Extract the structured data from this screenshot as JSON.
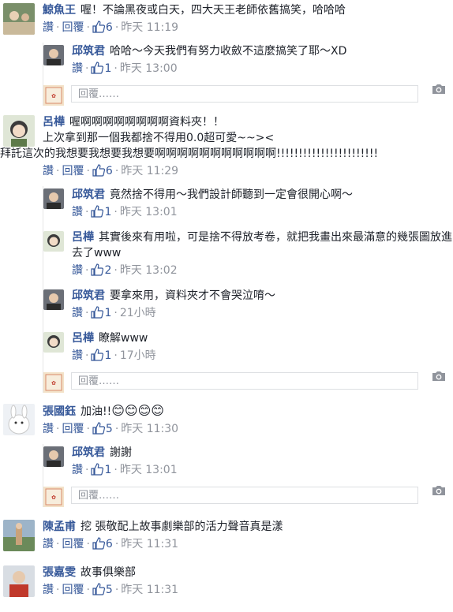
{
  "labels": {
    "like": "讚",
    "reply": "回覆",
    "reply_placeholder": "回覆……"
  },
  "colors": {
    "link": "#365899",
    "meta": "#90949c",
    "border": "#dddfe2"
  },
  "comments": [
    {
      "author": "鯨魚王",
      "text": "喔！不論黑夜或白天，四大天王老師依舊搞笑，哈哈哈",
      "likes": "6",
      "time": "昨天 11:19",
      "replies": [
        {
          "author": "邱筑君",
          "text": "哈哈～今天我們有努力收斂不這麼搞笑了耶～XD",
          "likes": "1",
          "time": "昨天 13:00"
        }
      ]
    },
    {
      "author": "呂樺",
      "text": "喔啊啊啊啊啊啊啊啊資料夾！！",
      "text2": "上次拿到那一個我都捨不得用0.0超可愛~~><",
      "text3": "拜託這次的我想要我想要我想要啊啊啊啊啊啊啊啊啊啊啊!!!!!!!!!!!!!!!!!!!!!!!",
      "likes": "6",
      "time": "昨天 11:29",
      "replies": [
        {
          "author": "邱筑君",
          "text": "竟然捨不得用～我們設計師聽到一定會很開心啊～",
          "likes": "1",
          "time": "昨天 13:01"
        },
        {
          "author": "呂樺",
          "text": "其實後來有用啦，可是捨不得放考卷，就把我畫出來最滿意的幾張圖放進去了www",
          "likes": "2",
          "time": "昨天 13:02"
        },
        {
          "author": "邱筑君",
          "text": "要拿來用，資料夾才不會哭泣唷～",
          "likes": "1",
          "time": "21小時"
        },
        {
          "author": "呂樺",
          "text": "瞭解www",
          "likes": "1",
          "time": "17小時"
        }
      ]
    },
    {
      "author": "張國鈺",
      "text": "加油!!",
      "emoji": "😊😊😊😊",
      "likes": "5",
      "time": "昨天 11:30",
      "replies": [
        {
          "author": "邱筑君",
          "text": "謝謝",
          "likes": "1",
          "time": "昨天 13:01"
        }
      ]
    },
    {
      "author": "陳孟甫",
      "text": "挖 張敬配上故事劇樂部的活力聲音真是漾",
      "likes": "6",
      "time": "昨天 11:31"
    },
    {
      "author": "張嘉雯",
      "text": "故事俱樂部",
      "likes": "5",
      "time": "昨天 11:31"
    }
  ]
}
